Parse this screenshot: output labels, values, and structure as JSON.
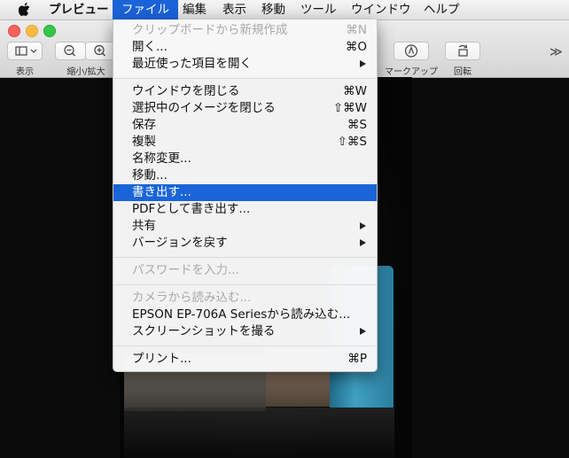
{
  "menubar": {
    "items": [
      {
        "label": "プレビュー"
      },
      {
        "label": "ファイル"
      },
      {
        "label": "編集"
      },
      {
        "label": "表示"
      },
      {
        "label": "移動"
      },
      {
        "label": "ツール"
      },
      {
        "label": "ウインドウ"
      },
      {
        "label": "ヘルプ"
      }
    ],
    "active": "ファイル"
  },
  "toolbar": {
    "view_label": "表示",
    "zoom_label": "縮小/拡大",
    "markup_label": "マークアップ",
    "rotate_label": "回転",
    "overflow": "≫"
  },
  "file_menu": {
    "items": [
      {
        "label": "クリップボードから新規作成",
        "shortcut": "⌘N",
        "enabled": false
      },
      {
        "label": "開く...",
        "shortcut": "⌘O",
        "enabled": true
      },
      {
        "label": "最近使った項目を開く",
        "shortcut": "",
        "enabled": true,
        "submenu": true
      },
      {
        "label": "ウインドウを閉じる",
        "shortcut": "⌘W",
        "enabled": true
      },
      {
        "label": "選択中のイメージを閉じる",
        "shortcut": "⇧⌘W",
        "enabled": true
      },
      {
        "label": "保存",
        "shortcut": "⌘S",
        "enabled": true
      },
      {
        "label": "複製",
        "shortcut": "⇧⌘S",
        "enabled": true
      },
      {
        "label": "名称変更...",
        "shortcut": "",
        "enabled": true
      },
      {
        "label": "移動...",
        "shortcut": "",
        "enabled": true
      },
      {
        "label": "書き出す...",
        "shortcut": "",
        "enabled": true,
        "selected": true
      },
      {
        "label": "PDFとして書き出す...",
        "shortcut": "",
        "enabled": true
      },
      {
        "label": "共有",
        "shortcut": "",
        "enabled": true,
        "submenu": true
      },
      {
        "label": "バージョンを戻す",
        "shortcut": "",
        "enabled": true,
        "submenu": true
      },
      {
        "label": "パスワードを入力...",
        "shortcut": "",
        "enabled": false
      },
      {
        "label": "カメラから読み込む...",
        "shortcut": "",
        "enabled": false
      },
      {
        "label": "EPSON EP-706A Seriesから読み込む...",
        "shortcut": "",
        "enabled": true
      },
      {
        "label": "スクリーンショットを撮る",
        "shortcut": "",
        "enabled": true,
        "submenu": true
      },
      {
        "label": "プリント...",
        "shortcut": "⌘P",
        "enabled": true
      }
    ]
  },
  "colors": {
    "highlight": "#1a64d8",
    "disabled_text": "#a9a9a9",
    "close": "#fc605b",
    "minimize": "#fdbc40",
    "zoom": "#34c84a"
  }
}
